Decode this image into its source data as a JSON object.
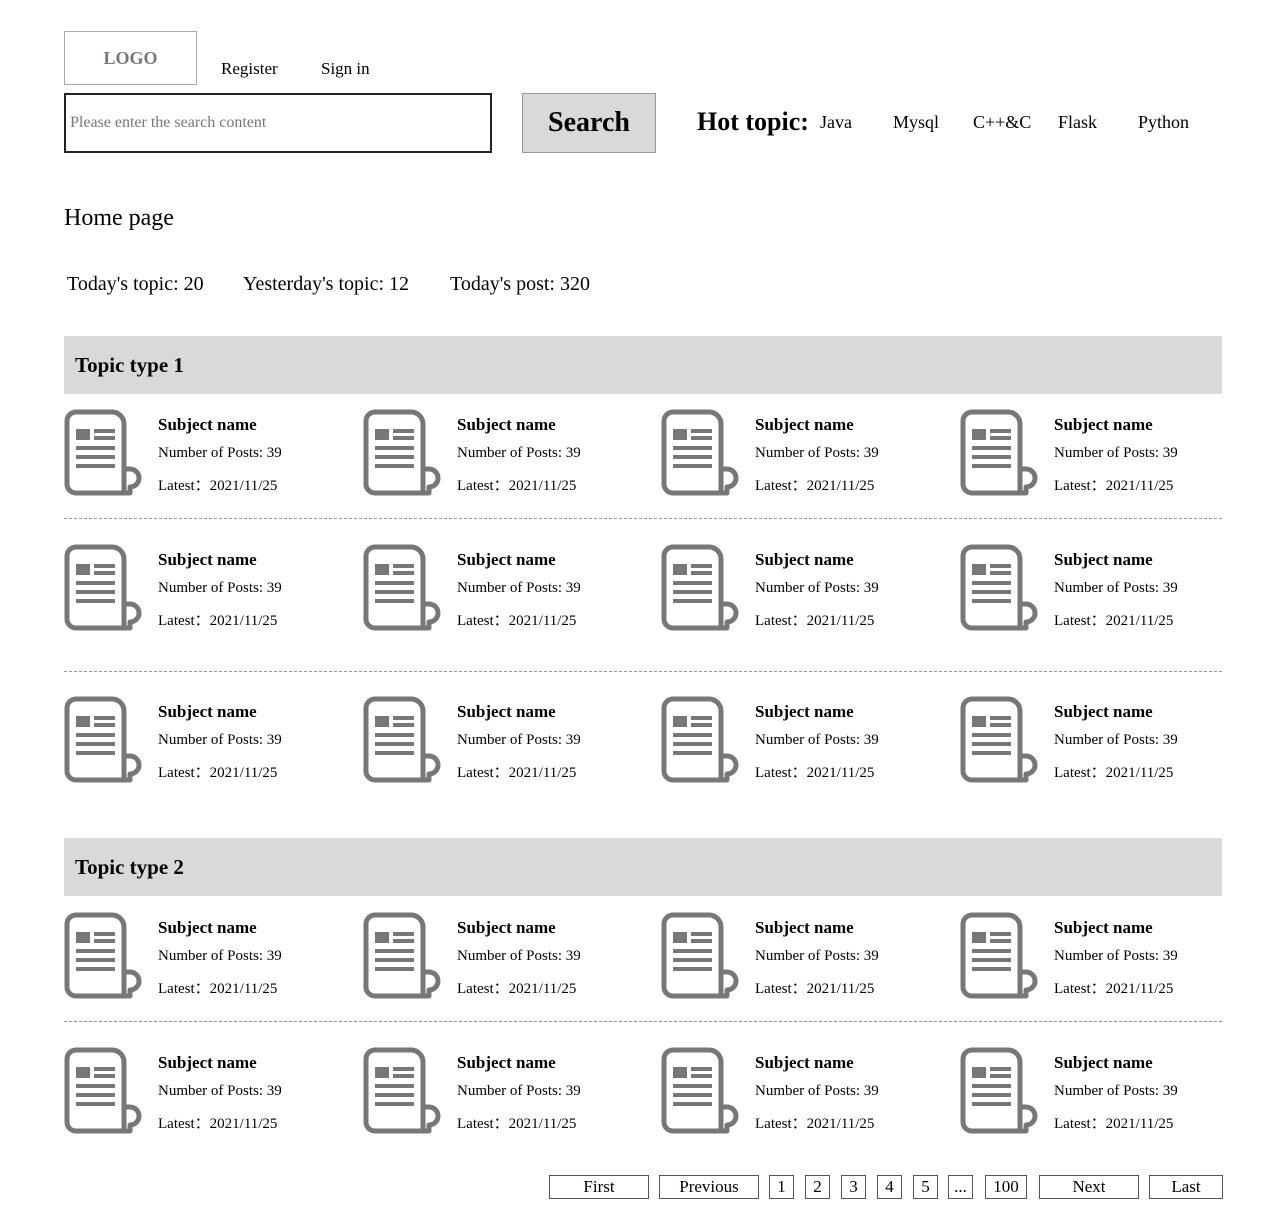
{
  "header": {
    "logo": "LOGO",
    "register": "Register",
    "sign_in": "Sign in",
    "search_placeholder": "Please enter the search content",
    "search_button": "Search",
    "hot_topic_label": "Hot topic:",
    "hot_topics": [
      "Java",
      "Mysql",
      "C++&C",
      "Flask",
      "Python"
    ]
  },
  "main": {
    "page_title": "Home page",
    "stats": {
      "today_topic": "Today's topic: 20",
      "yesterday_topic": "Yesterday's topic: 12",
      "today_post": "Today's post: 320"
    },
    "card_template": {
      "subject": "Subject name",
      "posts": "Number of Posts: 39",
      "latest": "Latest：2021/11/25"
    },
    "sections": [
      {
        "title": "Topic type 1",
        "rows": 3,
        "cards_per_row": 4
      },
      {
        "title": "Topic type 2",
        "rows": 2,
        "cards_per_row": 4
      }
    ]
  },
  "pagination": {
    "first": "First",
    "previous": "Previous",
    "pages": [
      "1",
      "2",
      "3",
      "4",
      "5",
      "...",
      "100"
    ],
    "next": "Next",
    "last": "Last"
  },
  "colors": {
    "section_header_bg": "#d9d9d9",
    "icon_gray": "#777777",
    "search_button_bg": "#d9d9d9"
  },
  "icons": {
    "topic_card": "document-icon"
  }
}
